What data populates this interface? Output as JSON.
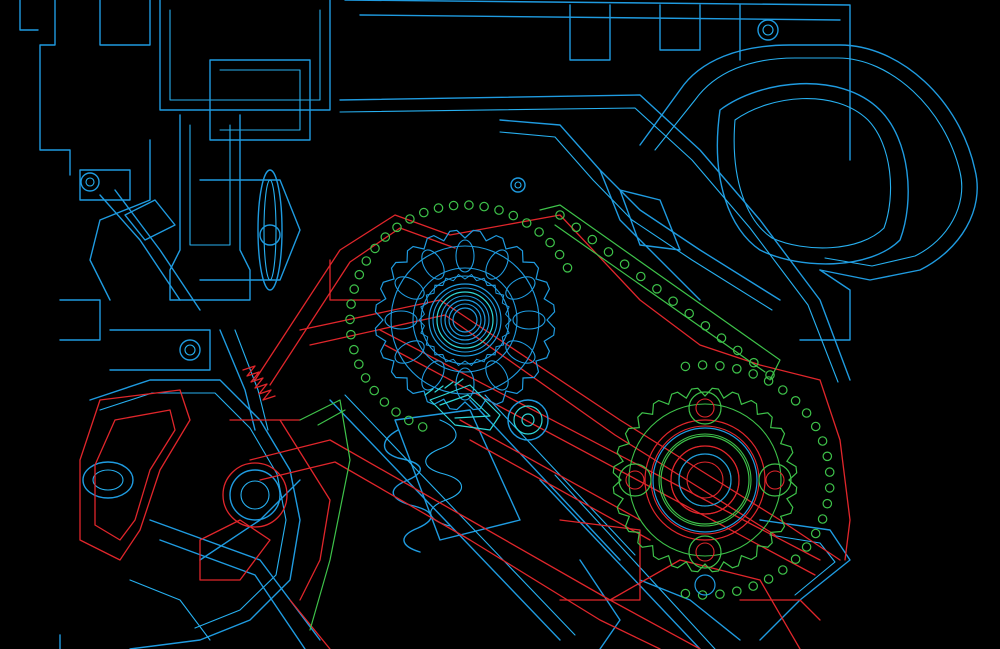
{
  "colors": {
    "background": "#000000",
    "outline_blue": "#1f9be0",
    "outline_red": "#e0262b",
    "outline_green": "#3ec24a",
    "outline_cyan": "#2fd6d6"
  },
  "chain": {
    "upper_pins": 30,
    "lower_pins": 26,
    "guide_pins": 14
  },
  "sprockets": {
    "upper_teeth": 24,
    "lower_teeth": 28
  }
}
